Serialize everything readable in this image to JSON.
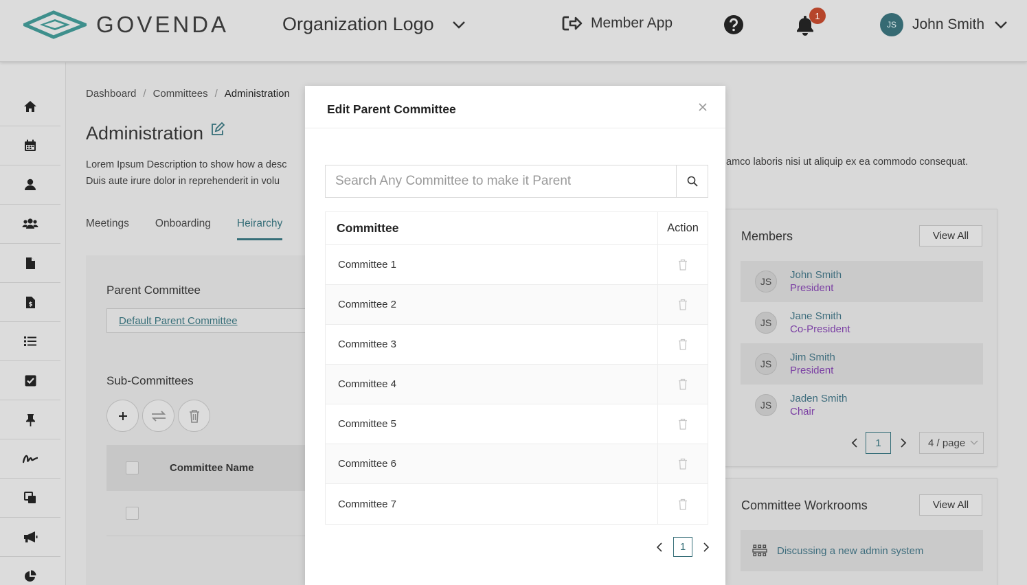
{
  "header": {
    "brand": "GOVENDA",
    "organization": "Organization Logo",
    "member_app": "Member App",
    "notification_count": "1",
    "user_initials": "JS",
    "user_name": "John Smith"
  },
  "sidebar": {
    "icons": [
      "home-icon",
      "calendar-icon",
      "user-icon",
      "users-icon",
      "document-icon",
      "invoice-icon",
      "list-icon",
      "checkbox-icon",
      "pin-icon",
      "signature-icon",
      "copy-icon",
      "megaphone-icon",
      "pie-chart-icon"
    ]
  },
  "breadcrumb": {
    "items": [
      "Dashboard",
      "Committees",
      "Administration"
    ],
    "separator": "/"
  },
  "page": {
    "title": "Administration",
    "description_line1": "Lorem Ipsum Description to show how a desc",
    "description_line2": "Duis aute irure dolor in reprehenderit in volu",
    "description_right": "amco laboris nisi ut aliquip ex ea commodo consequat."
  },
  "tabs": [
    "Meetings",
    "Onboarding",
    "Heirarchy"
  ],
  "active_tab": "Heirarchy",
  "left_panel": {
    "parent_label": "Parent Committee",
    "parent_value": "Default Parent Committee",
    "sub_label": "Sub-Committees",
    "table_header": "Committee Name"
  },
  "members_card": {
    "title": "Members",
    "view_all": "View All",
    "members": [
      {
        "initials": "JS",
        "name": "John Smith",
        "role": "President"
      },
      {
        "initials": "JS",
        "name": "Jane Smith",
        "role": "Co-President"
      },
      {
        "initials": "JS",
        "name": "Jim Smith",
        "role": "President"
      },
      {
        "initials": "JS",
        "name": "Jaden Smith",
        "role": "Chair"
      }
    ],
    "page": "1",
    "per_page": "4 / page"
  },
  "workrooms_card": {
    "title": "Committee Workrooms",
    "view_all": "View All",
    "item": "Discussing a new admin system"
  },
  "modal": {
    "title": "Edit Parent Committee",
    "search_placeholder": "Search Any Committee to make it Parent",
    "columns": [
      "Committee",
      "Action"
    ],
    "rows": [
      "Committee 1",
      "Committee 2",
      "Committee 3",
      "Committee 4",
      "Committee 5",
      "Committee 6",
      "Committee 7"
    ],
    "page": "1"
  },
  "colors": {
    "accent": "#366e78",
    "role": "#7a3ea3",
    "badge": "#b6452b"
  }
}
